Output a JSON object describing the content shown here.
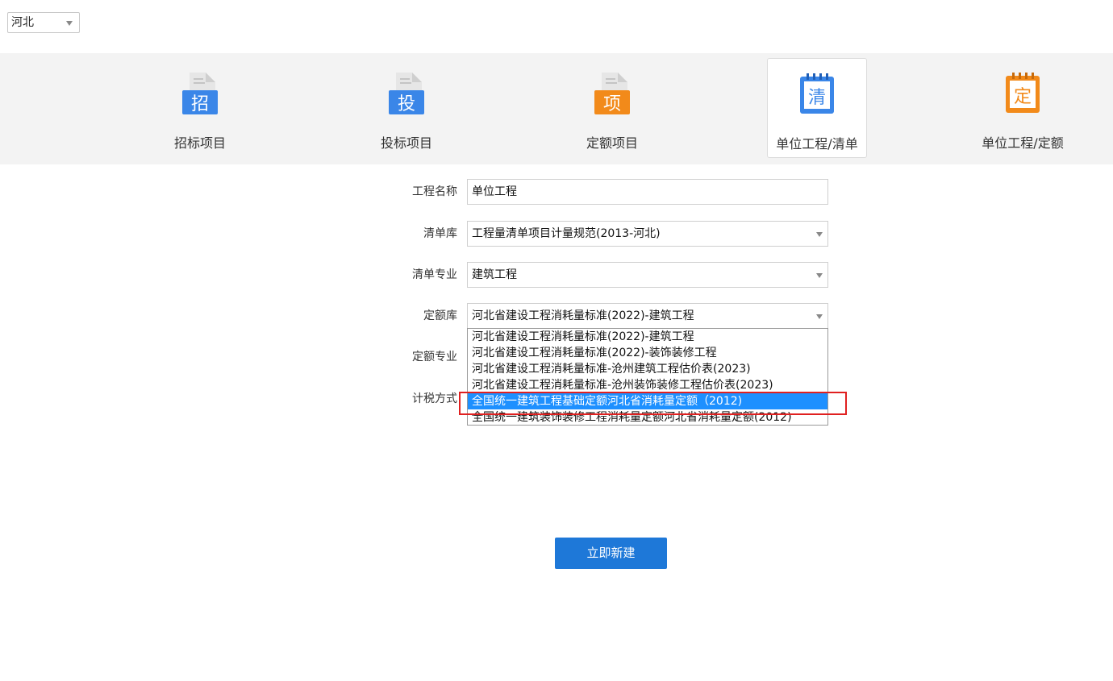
{
  "region": {
    "value": "河北"
  },
  "project_types": [
    {
      "label": "招标项目",
      "icon_char": "招",
      "icon": "bid-doc-icon",
      "color": "#3a86e8"
    },
    {
      "label": "投标项目",
      "icon_char": "投",
      "icon": "tender-doc-icon",
      "color": "#3a86e8"
    },
    {
      "label": "定额项目",
      "icon_char": "项",
      "icon": "quota-project-doc-icon",
      "color": "#f28a1a"
    },
    {
      "label": "单位工程/清单",
      "icon_char": "清",
      "icon": "bill-notepad-icon",
      "color": "#3a86e8",
      "active": true
    },
    {
      "label": "单位工程/定额",
      "icon_char": "定",
      "icon": "quota-notepad-icon",
      "color": "#f28a1a"
    }
  ],
  "form": {
    "project_name": {
      "label": "工程名称",
      "value": "单位工程"
    },
    "bill_library": {
      "label": "清单库",
      "value": "工程量清单项目计量规范(2013-河北)"
    },
    "bill_specialty": {
      "label": "清单专业",
      "value": "建筑工程"
    },
    "quota_library": {
      "label": "定额库",
      "value": "河北省建设工程消耗量标准(2022)-建筑工程"
    },
    "quota_specialty": {
      "label": "定额专业"
    },
    "tax_method": {
      "label": "计税方式"
    }
  },
  "quota_library_options": [
    "河北省建设工程消耗量标准(2022)-建筑工程",
    "河北省建设工程消耗量标准(2022)-装饰装修工程",
    "河北省建设工程消耗量标准-沧州建筑工程估价表(2023)",
    "河北省建设工程消耗量标准-沧州装饰装修工程估价表(2023)",
    "全国统一建筑工程基础定额河北省消耗量定额（2012)",
    "全国统一建筑装饰装修工程消耗量定额河北省消耗量定额(2012)"
  ],
  "selected_option_index": 4,
  "create_button": "立即新建",
  "colors": {
    "accent": "#1e78d8",
    "selection": "#1e90ff",
    "highlight": "#e02020"
  }
}
